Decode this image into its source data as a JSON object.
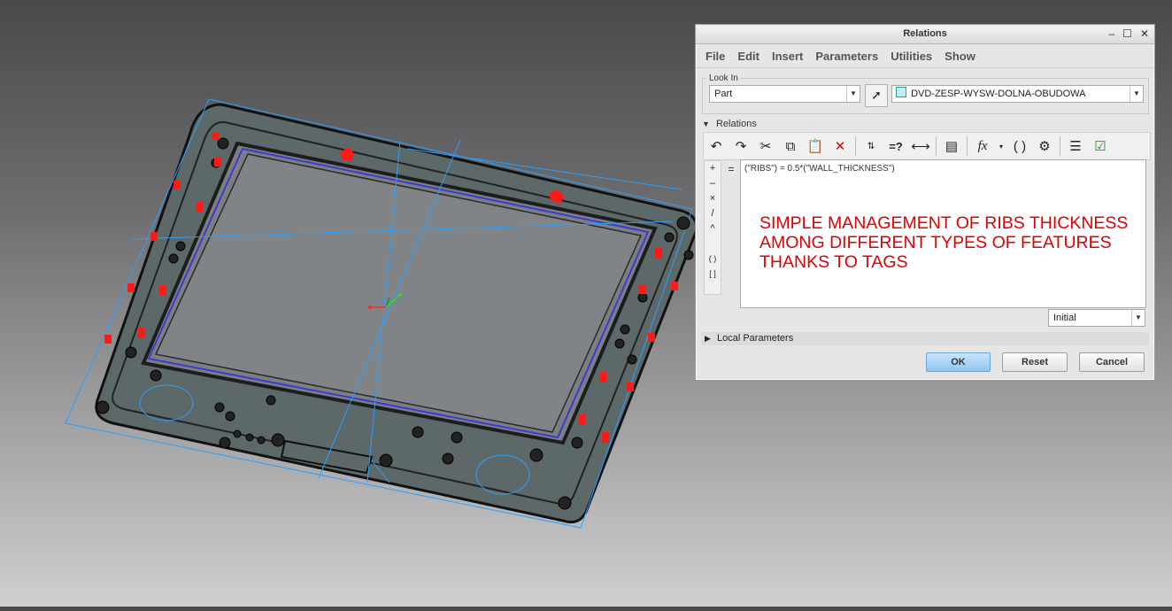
{
  "dialog": {
    "title": "Relations",
    "window_buttons": {
      "minimize": "–",
      "maximize": "☐",
      "close": "✕"
    },
    "menu": [
      "File",
      "Edit",
      "Insert",
      "Parameters",
      "Utilities",
      "Show"
    ],
    "look_in": {
      "legend": "Look In",
      "type_value": "Part",
      "model_value": "DVD-ZESP-WYSW-DOLNA-OBUDOWA"
    },
    "relations_header": "Relations",
    "operators": [
      "+",
      "–",
      "×",
      "/",
      "^",
      "( )",
      "[ ]"
    ],
    "equals": "=",
    "relation_text": "(\"RIBS\") = 0.5*(\"WALL_THICKNESS\")",
    "note_text": "SIMPLE MANAGEMENT OF RIBS THICKNESS\nAMONG DIFFERENT TYPES OF FEATURES\nTHANKS TO TAGS",
    "sort_value": "Initial",
    "local_parameters_label": "Local Parameters",
    "buttons": {
      "ok": "OK",
      "reset": "Reset",
      "cancel": "Cancel"
    }
  },
  "colors": {
    "note": "#e00000",
    "model_body": "#5f6a6a",
    "model_edges": "#1a1a1a",
    "datum_lines": "#2aa0ff",
    "rib_tags": "#ff1a1a",
    "ok_button": "#8ec6f2"
  }
}
